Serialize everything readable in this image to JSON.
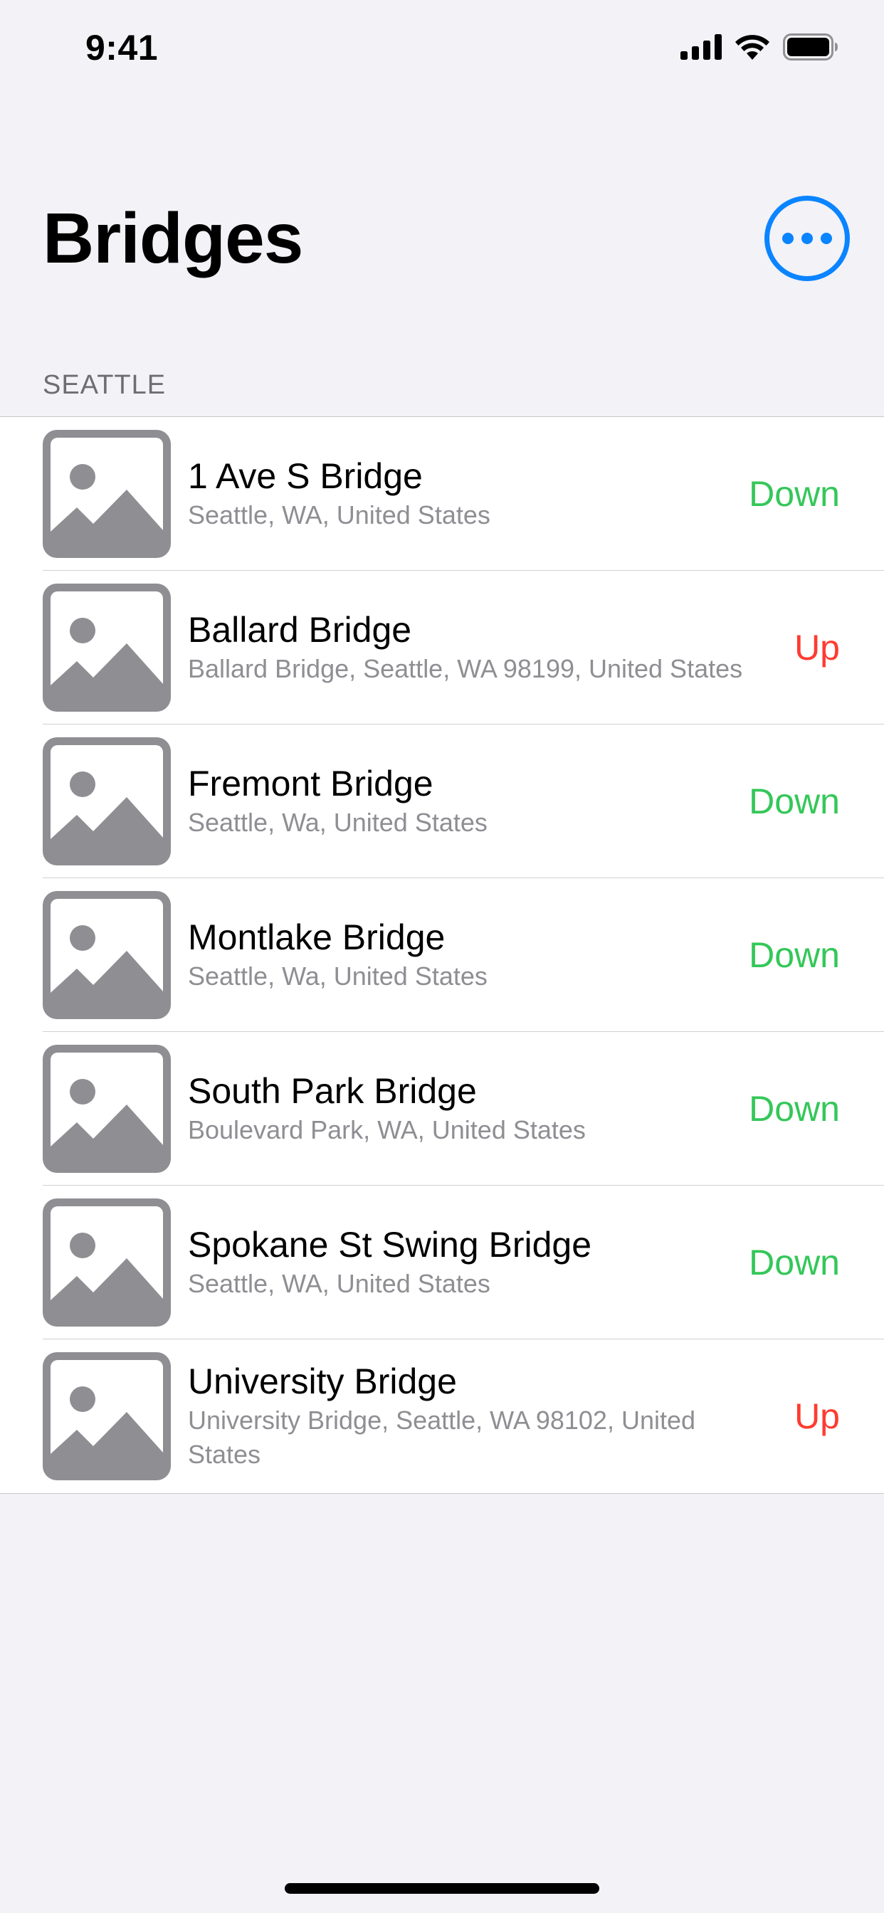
{
  "status_bar": {
    "time": "9:41",
    "icons": [
      "cellular-signal-icon",
      "wifi-icon",
      "battery-icon"
    ]
  },
  "header": {
    "title": "Bridges",
    "more_button_icon": "ellipsis-circle-icon",
    "accent_color": "#0A84FF"
  },
  "section": {
    "title": "SEATTLE"
  },
  "bridges": [
    {
      "name": "1 Ave S Bridge",
      "location": "Seattle, WA, United States",
      "status": "Down",
      "status_color": "#34C759",
      "thumbnail_icon": "photo-placeholder-icon"
    },
    {
      "name": "Ballard Bridge",
      "location": "Ballard Bridge, Seattle, WA 98199, United States",
      "status": "Up",
      "status_color": "#FF3B30",
      "thumbnail_icon": "photo-placeholder-icon"
    },
    {
      "name": "Fremont Bridge",
      "location": "Seattle, Wa, United States",
      "status": "Down",
      "status_color": "#34C759",
      "thumbnail_icon": "photo-placeholder-icon"
    },
    {
      "name": "Montlake Bridge",
      "location": "Seattle, Wa, United States",
      "status": "Down",
      "status_color": "#34C759",
      "thumbnail_icon": "photo-placeholder-icon"
    },
    {
      "name": "South Park Bridge",
      "location": "Boulevard Park, WA, United States",
      "status": "Down",
      "status_color": "#34C759",
      "thumbnail_icon": "photo-placeholder-icon"
    },
    {
      "name": "Spokane St Swing Bridge",
      "location": "Seattle, WA, United States",
      "status": "Down",
      "status_color": "#34C759",
      "thumbnail_icon": "photo-placeholder-icon"
    },
    {
      "name": "University Bridge",
      "location": "University Bridge, Seattle, WA  98102, United States",
      "status": "Up",
      "status_color": "#FF3B30",
      "thumbnail_icon": "photo-placeholder-icon"
    }
  ]
}
